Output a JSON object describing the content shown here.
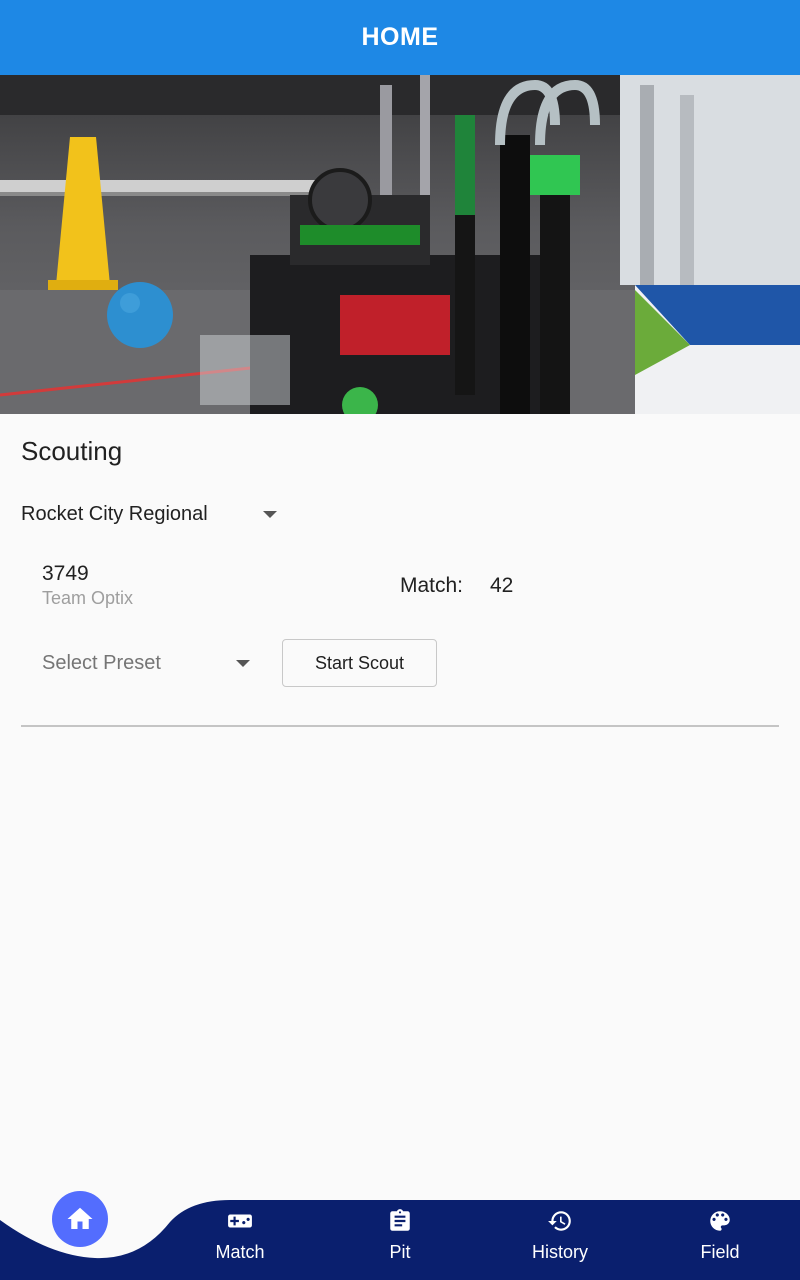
{
  "appbar": {
    "title": "HOME"
  },
  "scouting": {
    "section_title": "Scouting",
    "event": "Rocket City Regional",
    "team_number": "3749",
    "team_name": "Team Optix",
    "match_label": "Match:",
    "match_number": "42",
    "preset_placeholder": "Select Preset",
    "start_button": "Start Scout"
  },
  "bottom_nav": {
    "items": [
      {
        "label": "Match",
        "icon": "gamepad-icon"
      },
      {
        "label": "Pit",
        "icon": "clipboard-icon"
      },
      {
        "label": "History",
        "icon": "history-icon"
      },
      {
        "label": "Field",
        "icon": "palette-icon"
      }
    ],
    "home_icon": "home-icon"
  },
  "colors": {
    "appbar": "#1e88e5",
    "nav_bar": "#0a1f6e",
    "home_fab": "#536dfe",
    "background": "#fafafa"
  }
}
